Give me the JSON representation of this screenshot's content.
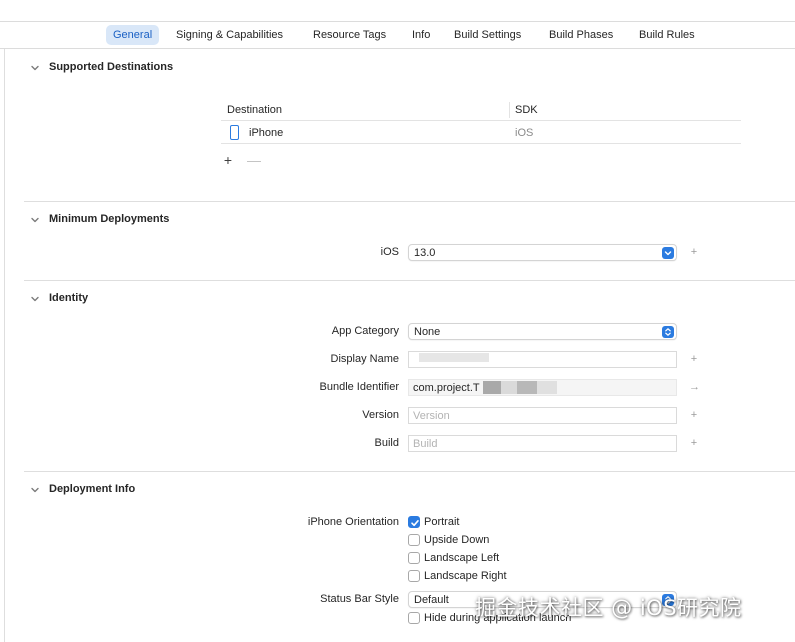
{
  "tabs": [
    {
      "label": "General",
      "active": true
    },
    {
      "label": "Signing & Capabilities",
      "active": false
    },
    {
      "label": "Resource Tags",
      "active": false
    },
    {
      "label": "Info",
      "active": false
    },
    {
      "label": "Build Settings",
      "active": false
    },
    {
      "label": "Build Phases",
      "active": false
    },
    {
      "label": "Build Rules",
      "active": false
    }
  ],
  "sections": {
    "supported_destinations": {
      "title": "Supported Destinations",
      "table": {
        "headers": [
          "Destination",
          "SDK"
        ],
        "rows": [
          {
            "destination": "iPhone",
            "sdk": "iOS"
          }
        ]
      },
      "add_label": "+",
      "remove_label": "—"
    },
    "minimum_deployments": {
      "title": "Minimum Deployments",
      "ios_label": "iOS",
      "ios_value": "13.0"
    },
    "identity": {
      "title": "Identity",
      "app_category_label": "App Category",
      "app_category_value": "None",
      "display_name_label": "Display Name",
      "display_name_value": "",
      "bundle_identifier_label": "Bundle Identifier",
      "bundle_identifier_value": "com.project.T",
      "version_label": "Version",
      "version_placeholder": "Version",
      "build_label": "Build",
      "build_placeholder": "Build"
    },
    "deployment_info": {
      "title": "Deployment Info",
      "orientation_label": "iPhone Orientation",
      "orientations": [
        {
          "label": "Portrait",
          "checked": true
        },
        {
          "label": "Upside Down",
          "checked": false
        },
        {
          "label": "Landscape Left",
          "checked": false
        },
        {
          "label": "Landscape Right",
          "checked": false
        }
      ],
      "status_bar_label": "Status Bar Style",
      "status_bar_value": "Default",
      "hide_launch_label": "Hide during application launch",
      "hide_launch_checked": false
    }
  },
  "icons": {
    "plus": "+",
    "arrow": "→"
  },
  "watermark": "掘金技术社区 @ iOS研究院",
  "colors": {
    "accent": "#2b7be0",
    "active_tab_bg": "#d9e7f8",
    "active_tab_text": "#1a60c4"
  }
}
